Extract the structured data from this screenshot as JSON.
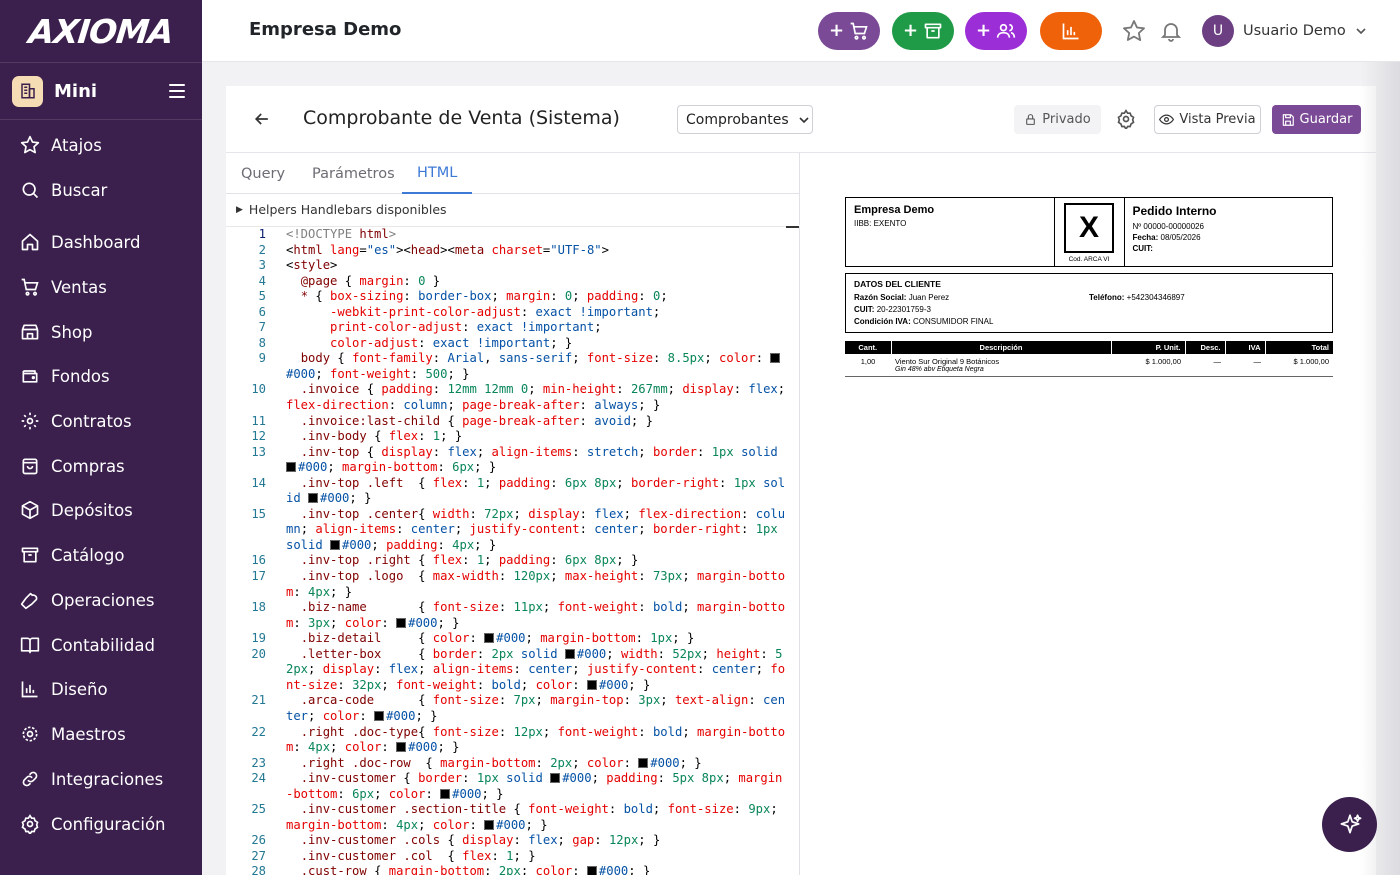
{
  "brand": {
    "logo_text": "AXIOMA"
  },
  "sidebar": {
    "mini_label": "Mini",
    "items": [
      {
        "label": "Atajos",
        "icon": "star-icon"
      },
      {
        "label": "Buscar",
        "icon": "search-icon"
      },
      {
        "label": "Dashboard",
        "icon": "home-icon"
      },
      {
        "label": "Ventas",
        "icon": "cart-icon"
      },
      {
        "label": "Shop",
        "icon": "store-icon"
      },
      {
        "label": "Fondos",
        "icon": "wallet-icon"
      },
      {
        "label": "Contratos",
        "icon": "gear-icon"
      },
      {
        "label": "Compras",
        "icon": "bag-icon"
      },
      {
        "label": "Depósitos",
        "icon": "package-icon"
      },
      {
        "label": "Catálogo",
        "icon": "archive-icon"
      },
      {
        "label": "Operaciones",
        "icon": "wrench-icon"
      },
      {
        "label": "Contabilidad",
        "icon": "book-icon"
      },
      {
        "label": "Diseño",
        "icon": "bar-chart-icon"
      },
      {
        "label": "Maestros",
        "icon": "cog-icon"
      },
      {
        "label": "Integraciones",
        "icon": "link-icon"
      },
      {
        "label": "Configuración",
        "icon": "settings-icon"
      }
    ]
  },
  "topbar": {
    "company": "Empresa Demo",
    "quick_actions": [
      {
        "label": "+",
        "icon": "cart-icon",
        "color": "#7a4a96"
      },
      {
        "label": "+",
        "icon": "archive-icon",
        "color": "#1f9a46"
      },
      {
        "label": "+",
        "icon": "users-icon",
        "color": "#9b2ed6"
      },
      {
        "label": "",
        "icon": "bar-chart-icon",
        "color": "#f0620a"
      }
    ],
    "user_initial": "U",
    "user_name": "Usuario Demo"
  },
  "page": {
    "title": "Comprobante de Venta (Sistema)",
    "dropdown_value": "Comprobantes",
    "private_label": "Privado",
    "preview_label": "Vista Previa",
    "save_label": "Guardar",
    "tabs": [
      "Query",
      "Parámetros",
      "HTML"
    ],
    "active_tab": "HTML",
    "helpers_label": "Helpers Handlebars disponibles"
  },
  "code_lines": [
    {
      "n": "1",
      "html": "<span class='k-cmt'>&lt;!DOCTYPE </span><span class='k-tag'>html</span><span class='k-cmt'>&gt;</span>"
    },
    {
      "n": "2",
      "html": "&lt;<span class='k-tag'>html</span> <span class='k-attr'>lang</span>=<span class='k-str'>\"es\"</span>&gt;&lt;<span class='k-tag'>head</span>&gt;&lt;<span class='k-tag'>meta</span> <span class='k-attr'>charset</span>=<span class='k-str'>\"UTF-8\"</span>&gt;"
    },
    {
      "n": "3",
      "html": "&lt;<span class='k-tag'>style</span>&gt;"
    },
    {
      "n": "4",
      "html": "  <span class='k-sel'>@page</span> { <span class='k-prop'>margin</span>: <span class='k-num'>0</span> }"
    },
    {
      "n": "5",
      "html": "  <span class='k-sel'>*</span> { <span class='k-prop'>box-sizing</span>: <span class='k-val'>border-box</span>; <span class='k-prop'>margin</span>: <span class='k-num'>0</span>; <span class='k-prop'>padding</span>: <span class='k-num'>0</span>;"
    },
    {
      "n": "6",
      "html": "      <span class='k-prop'>-webkit-print-color-adjust</span>: <span class='k-val'>exact</span> <span class='k-val'>!important</span>;"
    },
    {
      "n": "7",
      "html": "      <span class='k-prop'>print-color-adjust</span>: <span class='k-val'>exact</span> <span class='k-val'>!important</span>;"
    },
    {
      "n": "8",
      "html": "      <span class='k-prop'>color-adjust</span>: <span class='k-val'>exact</span> <span class='k-val'>!important</span>; }"
    },
    {
      "n": "9",
      "html": "  <span class='k-sel'>body</span> { <span class='k-prop'>font-family</span>: <span class='k-val'>Arial</span>, <span class='k-val'>sans-serif</span>; <span class='k-prop'>font-size</span>: <span class='k-num'>8.5px</span>; <span class='k-prop'>color</span>: <span class='sw'></span><span class='k-val'>#000</span>; <span class='k-prop'>font-weight</span>: <span class='k-num'>500</span>; }"
    },
    {
      "n": "10",
      "html": "  <span class='k-sel'>.invoice</span> { <span class='k-prop'>padding</span>: <span class='k-num'>12mm</span> <span class='k-num'>12mm</span> <span class='k-num'>0</span>; <span class='k-prop'>min-height</span>: <span class='k-num'>267mm</span>; <span class='k-prop'>display</span>: <span class='k-val'>flex</span>; <span class='k-prop'>flex-direction</span>: <span class='k-val'>column</span>; <span class='k-prop'>page-break-after</span>: <span class='k-val'>always</span>; }"
    },
    {
      "n": "11",
      "html": "  <span class='k-sel'>.invoice:last-child</span> { <span class='k-prop'>page-break-after</span>: <span class='k-val'>avoid</span>; }"
    },
    {
      "n": "12",
      "html": "  <span class='k-sel'>.inv-body</span> { <span class='k-prop'>flex</span>: <span class='k-num'>1</span>; }"
    },
    {
      "n": "13",
      "html": "  <span class='k-sel'>.inv-top</span> { <span class='k-prop'>display</span>: <span class='k-val'>flex</span>; <span class='k-prop'>align-items</span>: <span class='k-val'>stretch</span>; <span class='k-prop'>border</span>: <span class='k-num'>1px</span> <span class='k-val'>solid</span> <span class='sw'></span><span class='k-val'>#000</span>; <span class='k-prop'>margin-bottom</span>: <span class='k-num'>6px</span>; }"
    },
    {
      "n": "14",
      "html": "  <span class='k-sel'>.inv-top .left</span>  { <span class='k-prop'>flex</span>: <span class='k-num'>1</span>; <span class='k-prop'>padding</span>: <span class='k-num'>6px</span> <span class='k-num'>8px</span>; <span class='k-prop'>border-right</span>: <span class='k-num'>1px</span> <span class='k-val'>solid</span> <span class='sw'></span><span class='k-val'>#000</span>; }"
    },
    {
      "n": "15",
      "html": "  <span class='k-sel'>.inv-top .center</span>{ <span class='k-prop'>width</span>: <span class='k-num'>72px</span>; <span class='k-prop'>display</span>: <span class='k-val'>flex</span>; <span class='k-prop'>flex-direction</span>: <span class='k-val'>column</span>; <span class='k-prop'>align-items</span>: <span class='k-val'>center</span>; <span class='k-prop'>justify-content</span>: <span class='k-val'>center</span>; <span class='k-prop'>border-right</span>: <span class='k-num'>1px</span> <span class='k-val'>solid</span> <span class='sw'></span><span class='k-val'>#000</span>; <span class='k-prop'>padding</span>: <span class='k-num'>4px</span>; }"
    },
    {
      "n": "16",
      "html": "  <span class='k-sel'>.inv-top .right</span> { <span class='k-prop'>flex</span>: <span class='k-num'>1</span>; <span class='k-prop'>padding</span>: <span class='k-num'>6px</span> <span class='k-num'>8px</span>; }"
    },
    {
      "n": "17",
      "html": "  <span class='k-sel'>.inv-top .logo</span>  { <span class='k-prop'>max-width</span>: <span class='k-num'>120px</span>; <span class='k-prop'>max-height</span>: <span class='k-num'>73px</span>; <span class='k-prop'>margin-bottom</span>: <span class='k-num'>4px</span>; }"
    },
    {
      "n": "18",
      "html": "  <span class='k-sel'>.biz-name</span>       { <span class='k-prop'>font-size</span>: <span class='k-num'>11px</span>; <span class='k-prop'>font-weight</span>: <span class='k-val'>bold</span>; <span class='k-prop'>margin-bottom</span>: <span class='k-num'>3px</span>; <span class='k-prop'>color</span>: <span class='sw'></span><span class='k-val'>#000</span>; }"
    },
    {
      "n": "19",
      "html": "  <span class='k-sel'>.biz-detail</span>     { <span class='k-prop'>color</span>: <span class='sw'></span><span class='k-val'>#000</span>; <span class='k-prop'>margin-bottom</span>: <span class='k-num'>1px</span>; }"
    },
    {
      "n": "20",
      "html": "  <span class='k-sel'>.letter-box</span>     { <span class='k-prop'>border</span>: <span class='k-num'>2px</span> <span class='k-val'>solid</span> <span class='sw'></span><span class='k-val'>#000</span>; <span class='k-prop'>width</span>: <span class='k-num'>52px</span>; <span class='k-prop'>height</span>: <span class='k-num'>52px</span>; <span class='k-prop'>display</span>: <span class='k-val'>flex</span>; <span class='k-prop'>align-items</span>: <span class='k-val'>center</span>; <span class='k-prop'>justify-content</span>: <span class='k-val'>center</span>; <span class='k-prop'>font-size</span>: <span class='k-num'>32px</span>; <span class='k-prop'>font-weight</span>: <span class='k-val'>bold</span>; <span class='k-prop'>color</span>: <span class='sw'></span><span class='k-val'>#000</span>; }"
    },
    {
      "n": "21",
      "html": "  <span class='k-sel'>.arca-code</span>      { <span class='k-prop'>font-size</span>: <span class='k-num'>7px</span>; <span class='k-prop'>margin-top</span>: <span class='k-num'>3px</span>; <span class='k-prop'>text-align</span>: <span class='k-val'>center</span>; <span class='k-prop'>color</span>: <span class='sw'></span><span class='k-val'>#000</span>; }"
    },
    {
      "n": "22",
      "html": "  <span class='k-sel'>.right .doc-type</span>{ <span class='k-prop'>font-size</span>: <span class='k-num'>12px</span>; <span class='k-prop'>font-weight</span>: <span class='k-val'>bold</span>; <span class='k-prop'>margin-bottom</span>: <span class='k-num'>4px</span>; <span class='k-prop'>color</span>: <span class='sw'></span><span class='k-val'>#000</span>; }"
    },
    {
      "n": "23",
      "html": "  <span class='k-sel'>.right .doc-row</span>  { <span class='k-prop'>margin-bottom</span>: <span class='k-num'>2px</span>; <span class='k-prop'>color</span>: <span class='sw'></span><span class='k-val'>#000</span>; }"
    },
    {
      "n": "24",
      "html": "  <span class='k-sel'>.inv-customer</span> { <span class='k-prop'>border</span>: <span class='k-num'>1px</span> <span class='k-val'>solid</span> <span class='sw'></span><span class='k-val'>#000</span>; <span class='k-prop'>padding</span>: <span class='k-num'>5px</span> <span class='k-num'>8px</span>; <span class='k-prop'>margin-bottom</span>: <span class='k-num'>6px</span>; <span class='k-prop'>color</span>: <span class='sw'></span><span class='k-val'>#000</span>; }"
    },
    {
      "n": "25",
      "html": "  <span class='k-sel'>.inv-customer .section-title</span> { <span class='k-prop'>font-weight</span>: <span class='k-val'>bold</span>; <span class='k-prop'>font-size</span>: <span class='k-num'>9px</span>; <span class='k-prop'>margin-bottom</span>: <span class='k-num'>4px</span>; <span class='k-prop'>color</span>: <span class='sw'></span><span class='k-val'>#000</span>; }"
    },
    {
      "n": "26",
      "html": "  <span class='k-sel'>.inv-customer .cols</span> { <span class='k-prop'>display</span>: <span class='k-val'>flex</span>; <span class='k-prop'>gap</span>: <span class='k-num'>12px</span>; }"
    },
    {
      "n": "27",
      "html": "  <span class='k-sel'>.inv-customer .col</span>  { <span class='k-prop'>flex</span>: <span class='k-num'>1</span>; }"
    },
    {
      "n": "28",
      "html": "  <span class='k-sel'>.cust-row</span> { <span class='k-prop'>margin-bottom</span>: <span class='k-num'>2px</span>; <span class='k-prop'>color</span>: <span class='sw'></span><span class='k-val'>#000</span>; }"
    }
  ],
  "invoice": {
    "biz_name": "Empresa Demo",
    "biz_detail": "IIBB: EXENTO",
    "letter": "X",
    "arca_code": "Cod. ARCA VI",
    "doc_type": "Pedido Interno",
    "doc_number": "Nº 00000-00000026",
    "date_label": "Fecha:",
    "date_value": "08/05/2026",
    "cuit_label": "CUIT:",
    "customer_title": "DATOS DEL CLIENTE",
    "razon_label": "Razón Social:",
    "razon_value": "Juan Perez",
    "cuit_cli_label": "CUIT:",
    "cuit_cli_value": "20-22301759-3",
    "iva_label": "Condición IVA:",
    "iva_value": "CONSUMIDOR FINAL",
    "tel_label": "Teléfono:",
    "tel_value": "+542304346897",
    "headers": [
      "Cant.",
      "Descripción",
      "P. Unit.",
      "Desc.",
      "IVA",
      "Total"
    ],
    "item": {
      "qty": "1,00",
      "desc": "Viento Sur Original 9 Botánicos",
      "sub": "Gin 48% abv Etiqueta Negra",
      "unit": "$ 1.000,00",
      "discount": "—",
      "iva": "—",
      "total": "$ 1.000,00"
    }
  }
}
